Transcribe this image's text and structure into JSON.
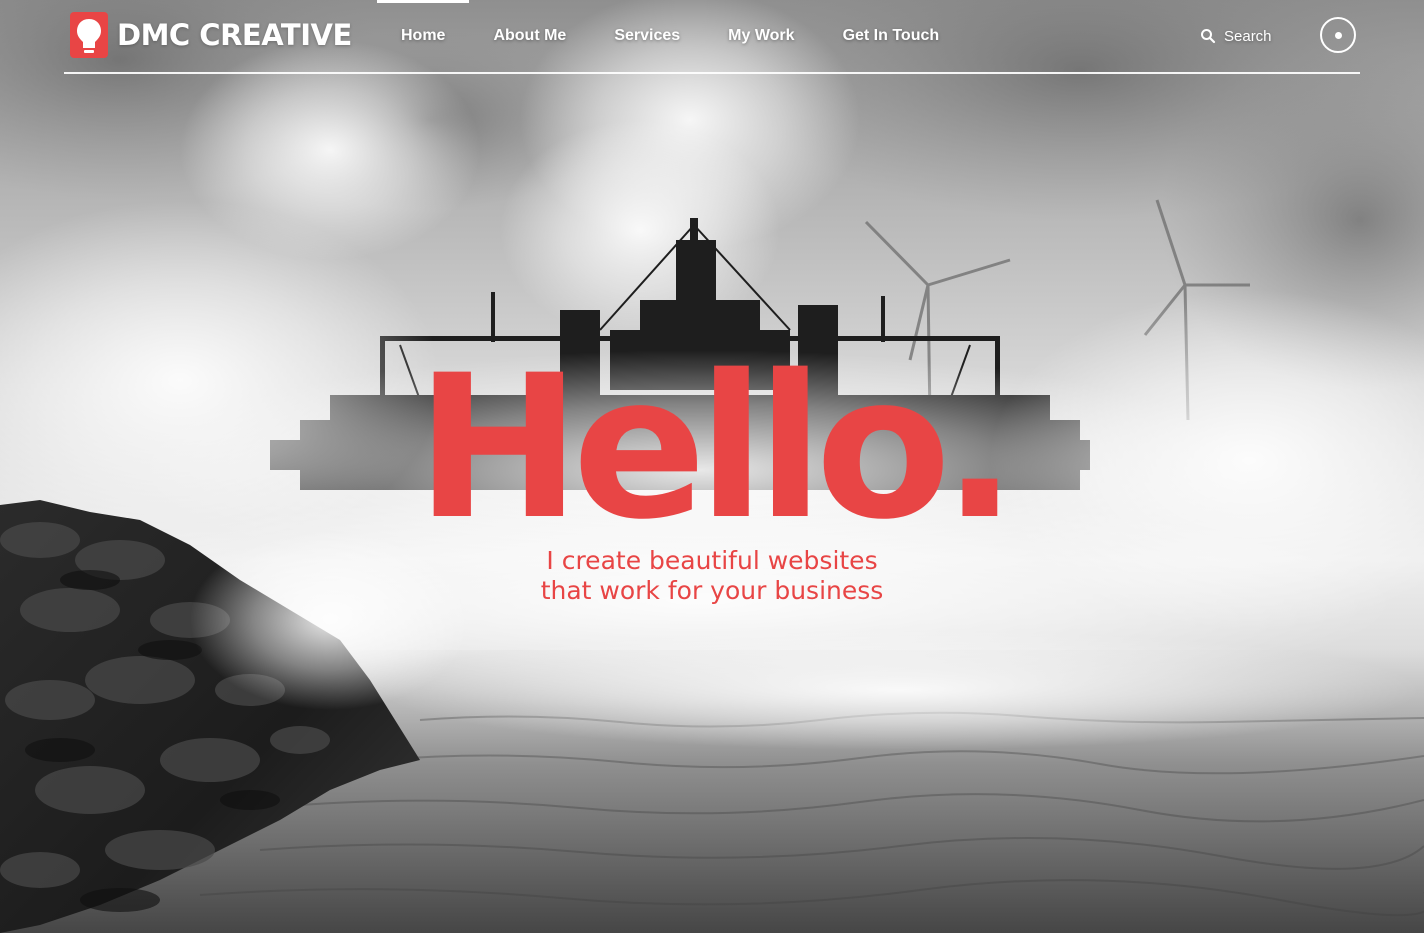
{
  "brand": {
    "name": "DMC CREATIVE",
    "accent_color": "#e84545",
    "logo_icon": "lightbulb-icon"
  },
  "nav": {
    "items": [
      {
        "label": "Home",
        "active": true
      },
      {
        "label": "About Me",
        "active": false
      },
      {
        "label": "Services",
        "active": false
      },
      {
        "label": "My Work",
        "active": false
      },
      {
        "label": "Get In Touch",
        "active": false
      }
    ]
  },
  "search": {
    "label": "Search",
    "icon": "search-icon"
  },
  "menu_toggle": {
    "icon": "dot-icon"
  },
  "hero": {
    "title": "Hello.",
    "subtitle_line1": "I create beautiful websites",
    "subtitle_line2": "that work for your business"
  }
}
